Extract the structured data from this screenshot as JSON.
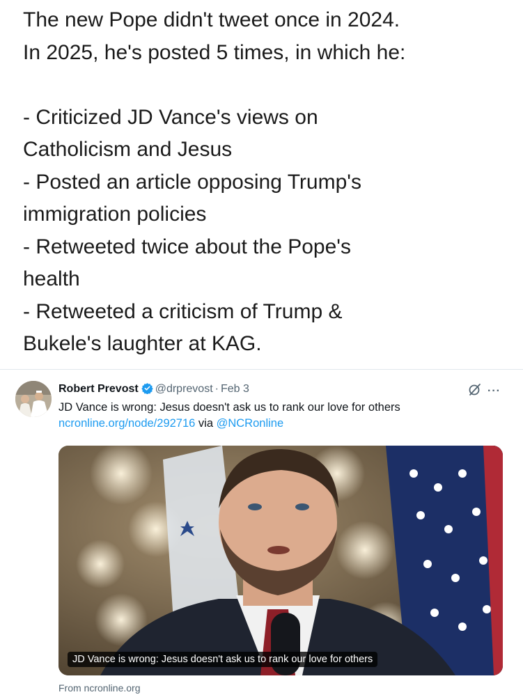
{
  "caption": {
    "lines": [
      "The new Pope didn't tweet once in 2024.",
      "In 2025, he's posted 5 times, in which he:",
      "- Criticized JD Vance's views on",
      "Catholicism and Jesus",
      "- Posted an article opposing Trump's",
      "immigration policies",
      "- Retweeted twice about the Pope's",
      "health",
      "- Retweeted a criticism of Trump &",
      "Bukele's laughter at KAG."
    ]
  },
  "tweet": {
    "author_name": "Robert Prevost",
    "handle": "@drprevost",
    "separator": "·",
    "date": "Feb 3",
    "text": "JD Vance is wrong: Jesus doesn't ask us to rank our love for others",
    "link_url": "ncronline.org/node/292716",
    "via_text": " via ",
    "via_handle": "@NCRonline",
    "more_label": "···",
    "icons": [
      "avatar",
      "verified-badge-icon",
      "grok-icon",
      "more-icon"
    ],
    "accent_color": "#1d9bf0"
  },
  "card": {
    "caption": "JD Vance is wrong: Jesus doesn't ask us to rank our love for others",
    "source": "From ncronline.org"
  }
}
